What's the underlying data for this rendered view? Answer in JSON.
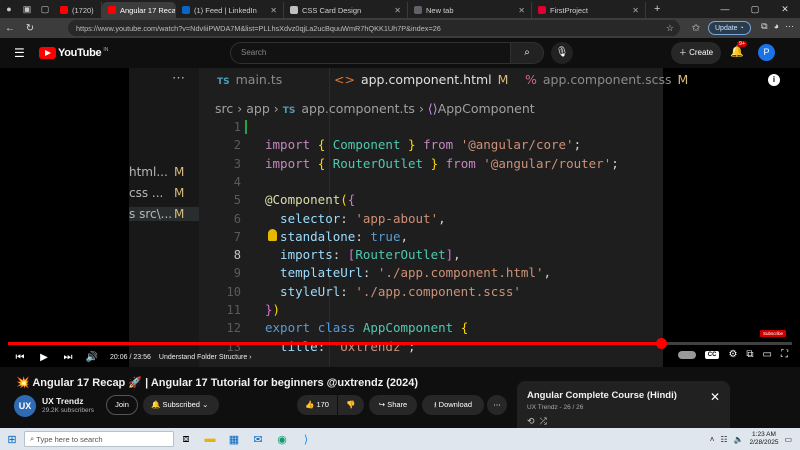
{
  "browser": {
    "tabs": [
      {
        "label": "(1720)",
        "color": "#ff0000",
        "active": false
      },
      {
        "label": "Angular 17 Recap 🚀",
        "color": "#ff0000",
        "active": true
      },
      {
        "label": "(1) Feed | LinkedIn",
        "color": "#0a66c2",
        "active": false
      },
      {
        "label": "CSS Card Design",
        "color": "#c0c0c0",
        "active": false
      },
      {
        "label": "New tab",
        "color": "#5f6368",
        "active": false
      },
      {
        "label": "FirstProject",
        "color": "#dd0031",
        "active": false
      }
    ],
    "url": "https://www.youtube.com/watch?v=NdvIiiPWDA7M&list=PLLhsXdvz0qjLa2ucBquuWmR7hQKK1Uh7P&index=26",
    "update_label": "Update",
    "new_tab": "+"
  },
  "youtube": {
    "logo_text": "YouTube",
    "country_code": "IN",
    "search_placeholder": "Search",
    "create_label": "Create",
    "notif_count": "9+",
    "avatar_letter": "P"
  },
  "editor": {
    "tabs": [
      {
        "icon": "TS",
        "label": "main.ts",
        "mod": ""
      },
      {
        "icon": "<>",
        "label": "app.component.html",
        "mod": "M"
      },
      {
        "icon": "%",
        "label": "app.component.scss",
        "mod": "M"
      }
    ],
    "breadcrumbs": {
      "src": "src",
      "sep1": "›",
      "app": "app",
      "sep2": "›",
      "ts_icon": "TS",
      "file": "app.component.ts",
      "sep3": "›",
      "symbol": "AppComponent"
    },
    "side_files": [
      {
        "name": "html...",
        "mod": "M"
      },
      {
        "name": "css ...",
        "mod": "M"
      },
      {
        "name": "s  src\\...",
        "mod": "M"
      }
    ],
    "line_numbers": [
      "1",
      "2",
      "3",
      "4",
      "5",
      "6",
      "7",
      "8",
      "9",
      "10",
      "11",
      "12",
      "13"
    ],
    "lines": [
      [],
      [
        [
          "kw",
          "import "
        ],
        [
          "pun2",
          "{ "
        ],
        [
          "cls",
          "Component"
        ],
        [
          "pun2",
          " } "
        ],
        [
          "kw",
          "from "
        ],
        [
          "str",
          "'@angular/core'"
        ],
        [
          "",
          "; "
        ]
      ],
      [
        [
          "kw",
          "import "
        ],
        [
          "pun2",
          "{ "
        ],
        [
          "cls",
          "RouterOutlet"
        ],
        [
          "pun2",
          " } "
        ],
        [
          "kw",
          "from "
        ],
        [
          "str",
          "'@angular/router'"
        ],
        [
          "",
          ";"
        ]
      ],
      [],
      [
        [
          "fn",
          "@Component"
        ],
        [
          "pun2",
          "("
        ],
        [
          "pun",
          "{"
        ]
      ],
      [
        [
          "prop",
          "  selector"
        ],
        [
          "",
          ": "
        ],
        [
          "str",
          "'app-about'"
        ],
        [
          "",
          ","
        ]
      ],
      [
        [
          "prop",
          "  standalone"
        ],
        [
          "",
          ": "
        ],
        [
          "kb",
          "true"
        ],
        [
          "",
          ","
        ]
      ],
      [
        [
          "prop",
          "  imports"
        ],
        [
          "",
          ": "
        ],
        [
          "pun",
          "["
        ],
        [
          "cls",
          "RouterOutlet"
        ],
        [
          "pun",
          "]"
        ],
        [
          "",
          ","
        ]
      ],
      [
        [
          "prop",
          "  templateUrl"
        ],
        [
          "",
          ": "
        ],
        [
          "str",
          "'./app.component.html'"
        ],
        [
          "",
          ","
        ]
      ],
      [
        [
          "prop",
          "  styleUrl"
        ],
        [
          "",
          ": "
        ],
        [
          "str",
          "'./app.component.scss'"
        ]
      ],
      [
        [
          "pun",
          "}"
        ],
        [
          "pun2",
          ")"
        ]
      ],
      [
        [
          "kb",
          "export "
        ],
        [
          "kb",
          "class "
        ],
        [
          "cls",
          "AppComponent "
        ],
        [
          "pun2",
          "{"
        ]
      ],
      [
        [
          "prop",
          "  title"
        ],
        [
          "",
          ": "
        ],
        [
          "str",
          "'Uxtrendz'"
        ],
        [
          "",
          ";"
        ]
      ]
    ]
  },
  "player": {
    "current_time": "20:06",
    "duration": "23:56",
    "time_sep": " / ",
    "chapter": "Understand Folder Structure",
    "progress_fraction": 0.833,
    "subscribe_watermark": "Subscribe"
  },
  "video": {
    "title_emoji": "💥",
    "title": "Angular 17 Recap 🚀 | Angular 17 Tutorial for beginners @uxtrendz (2024)",
    "channel_logo": "UX",
    "channel_name": "UX Trendz",
    "subscribers": "29.2K subscribers",
    "join_label": "Join",
    "subscribed_label": "Subscribed",
    "likes": "170",
    "share_label": "Share",
    "download_label": "Download"
  },
  "playlist": {
    "title": "Angular Complete Course (Hindi)",
    "subtitle": "UX Trendz - 26 / 26"
  },
  "taskbar": {
    "search_placeholder": "Type here to search",
    "time": "1:23 AM",
    "date": "2/28/2025"
  }
}
